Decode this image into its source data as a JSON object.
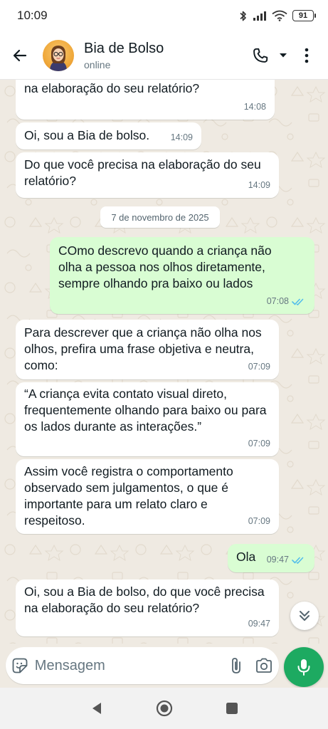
{
  "status_bar": {
    "time": "10:09",
    "battery": "91",
    "icons": [
      "bluetooth-icon",
      "signal-icon",
      "wifi-icon",
      "battery-icon"
    ]
  },
  "header": {
    "contact_name": "Bia de Bolso",
    "contact_status": "online",
    "icons": [
      "back-arrow-icon",
      "avatar",
      "phone-icon",
      "dropdown-caret-icon",
      "more-vertical-icon"
    ]
  },
  "chat": {
    "messages": [
      {
        "direction": "in",
        "text": "Oi, sou a Bia de bolso, do que você precisa na elaboração do seu relatório?",
        "time": "14:08"
      },
      {
        "direction": "in",
        "text": "Oi, sou a Bia de bolso.",
        "time": "14:09"
      },
      {
        "direction": "in",
        "text": "Do que você precisa na elaboração do seu relatório?",
        "time": "14:09"
      },
      {
        "direction": "out",
        "text": "COmo descrevo quando a criança não olha a pessoa nos olhos diretamente, sempre olhando pra baixo ou lados",
        "time": "07:08",
        "status": "read"
      },
      {
        "direction": "in",
        "text": "Para descrever que a criança não olha nos olhos, prefira uma frase objetiva e neutra, como:",
        "time": "07:09"
      },
      {
        "direction": "in",
        "text": "“A criança evita contato visual direto, frequentemente olhando para baixo ou para os lados durante as interações.”",
        "time": "07:09"
      },
      {
        "direction": "in",
        "text": "Assim você registra o comportamento observado sem julgamentos, o que é importante para um relato claro e respeitoso.",
        "time": "07:09"
      },
      {
        "direction": "out",
        "text": "Ola",
        "time": "09:47",
        "status": "read"
      },
      {
        "direction": "in",
        "text": "Oi, sou a Bia de bolso, do que você precisa na elaboração do seu relatório?",
        "time": "09:47"
      }
    ],
    "date_separator": "7 de novembro de 2025"
  },
  "composer": {
    "placeholder": "Mensagem",
    "icons": [
      "sticker-icon",
      "attach-icon",
      "camera-icon",
      "mic-icon"
    ]
  },
  "nav_bar": {
    "icons": [
      "nav-back-icon",
      "nav-home-icon",
      "nav-recents-icon"
    ]
  },
  "colors": {
    "incoming_bubble": "#ffffff",
    "outgoing_bubble": "#d9fdd3",
    "wallpaper": "#efeae2",
    "accent_green": "#1daa61",
    "read_ticks": "#53bdeb"
  }
}
